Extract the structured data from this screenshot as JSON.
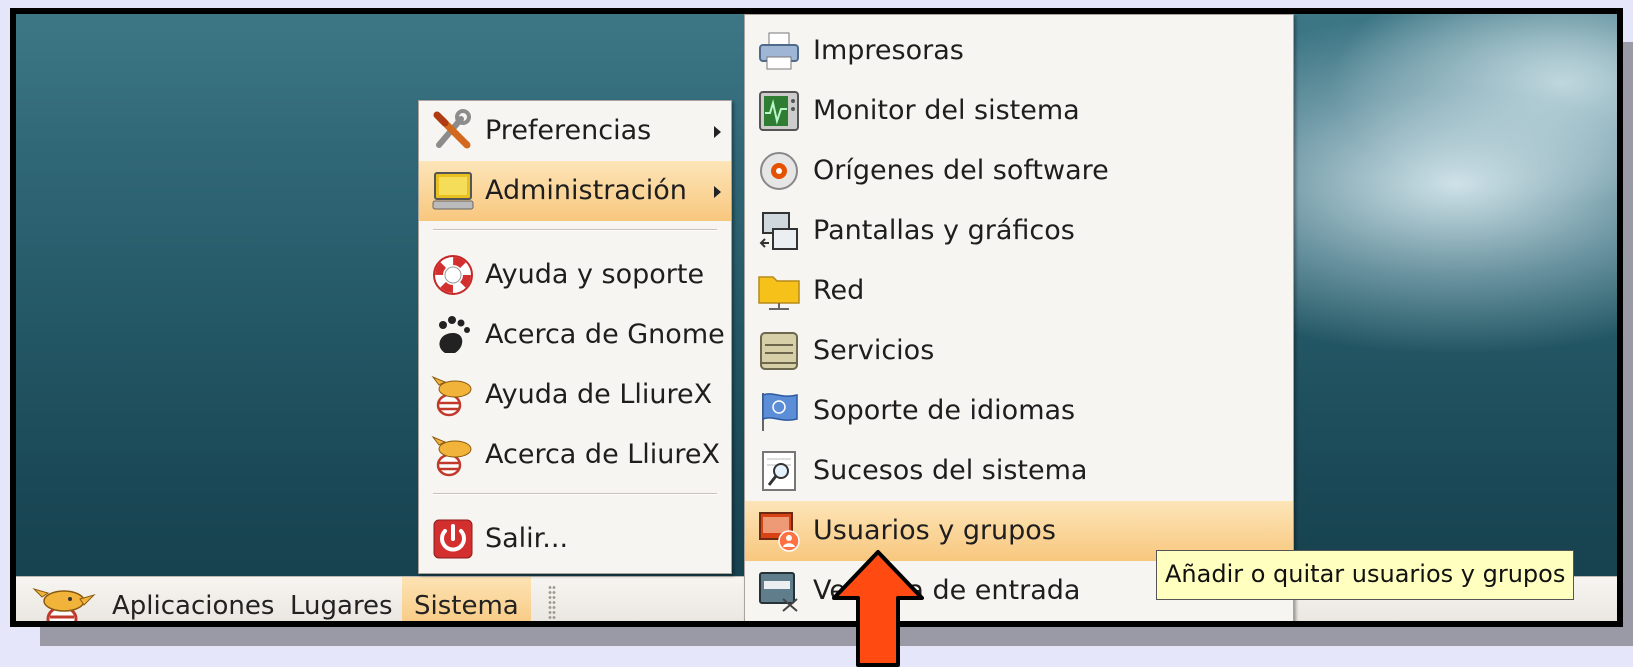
{
  "panel": {
    "logo_icon": "lliurex-mascot-icon",
    "items": [
      "Aplicaciones",
      "Lugares",
      "Sistema"
    ],
    "active_item": "Sistema"
  },
  "sistema_menu": {
    "items": [
      {
        "label": "Preferencias",
        "icon": "preferences-tools-icon",
        "submenu": true
      },
      {
        "label": "Administración",
        "icon": "administration-computer-icon",
        "submenu": true,
        "highlighted": true
      },
      {
        "label": "Ayuda y soporte",
        "icon": "lifebuoy-help-icon"
      },
      {
        "label": "Acerca de Gnome",
        "icon": "gnome-foot-icon"
      },
      {
        "label": "Ayuda de LliureX",
        "icon": "lliurex-mascot-icon"
      },
      {
        "label": "Acerca de LliureX",
        "icon": "lliurex-mascot-icon"
      },
      {
        "label": "Salir...",
        "icon": "power-icon"
      }
    ]
  },
  "administracion_menu": {
    "items": [
      {
        "label": "Impresoras",
        "icon": "printer-icon"
      },
      {
        "label": "Monitor del sistema",
        "icon": "system-monitor-icon"
      },
      {
        "label": "Orígenes del software",
        "icon": "software-sources-cd-icon"
      },
      {
        "label": "Pantallas y gráficos",
        "icon": "displays-graphics-icon"
      },
      {
        "label": "Red",
        "icon": "network-folder-icon"
      },
      {
        "label": "Servicios",
        "icon": "services-server-icon"
      },
      {
        "label": "Soporte de idiomas",
        "icon": "language-flag-icon"
      },
      {
        "label": "Sucesos del sistema",
        "icon": "system-log-magnifier-icon"
      },
      {
        "label": "Usuarios y grupos",
        "icon": "users-groups-icon",
        "highlighted": true
      },
      {
        "label": "Ventana de entrada",
        "icon": "login-window-icon"
      }
    ]
  },
  "tooltip": {
    "text": "Añadir o quitar usuarios y grupos"
  },
  "colors": {
    "highlight": "#f8c77e",
    "menu_bg": "#f7f5f1",
    "tooltip_bg": "#ffffbf",
    "annotation_arrow": "#ff4a12"
  }
}
